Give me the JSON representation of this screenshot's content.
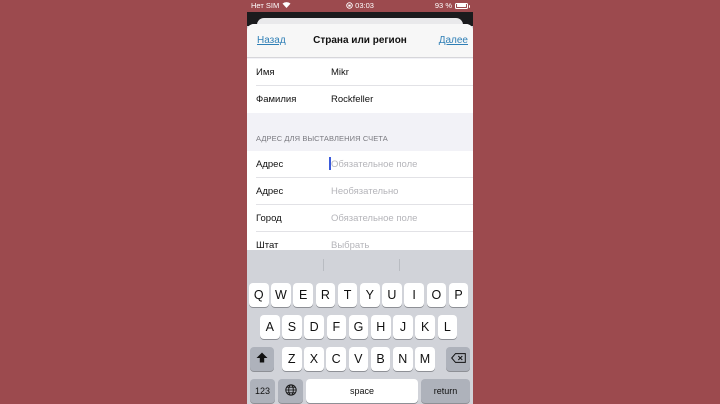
{
  "status_bar": {
    "carrier": "Нет SIM",
    "time": "03:03",
    "battery_percent": "93 %",
    "battery_level": 0.93
  },
  "nav": {
    "back_label": "Назад",
    "title": "Страна или регион",
    "next_label": "Далее"
  },
  "name_fields": [
    {
      "label": "Имя",
      "value": "Mikr"
    },
    {
      "label": "Фамилия",
      "value": "Rockfeller"
    }
  ],
  "billing": {
    "header": "АДРЕС ДЛЯ ВЫСТАВЛЕНИЯ СЧЕТА",
    "fields": [
      {
        "label": "Адрес",
        "placeholder": "Обязательное поле"
      },
      {
        "label": "Адрес",
        "placeholder": "Необязательно"
      },
      {
        "label": "Город",
        "placeholder": "Обязательное поле"
      },
      {
        "label": "Штат",
        "placeholder": "Выбрать"
      }
    ]
  },
  "keyboard": {
    "row1": [
      "Q",
      "W",
      "E",
      "R",
      "T",
      "Y",
      "U",
      "I",
      "O",
      "P"
    ],
    "row2": [
      "A",
      "S",
      "D",
      "F",
      "G",
      "H",
      "J",
      "K",
      "L"
    ],
    "row3": [
      "Z",
      "X",
      "C",
      "V",
      "B",
      "N",
      "M"
    ],
    "numbers_label": "123",
    "space_label": "space",
    "return_label": "return",
    "shift_icon": "shift-icon",
    "backspace_icon": "backspace-icon",
    "globe_icon": "globe-icon"
  }
}
